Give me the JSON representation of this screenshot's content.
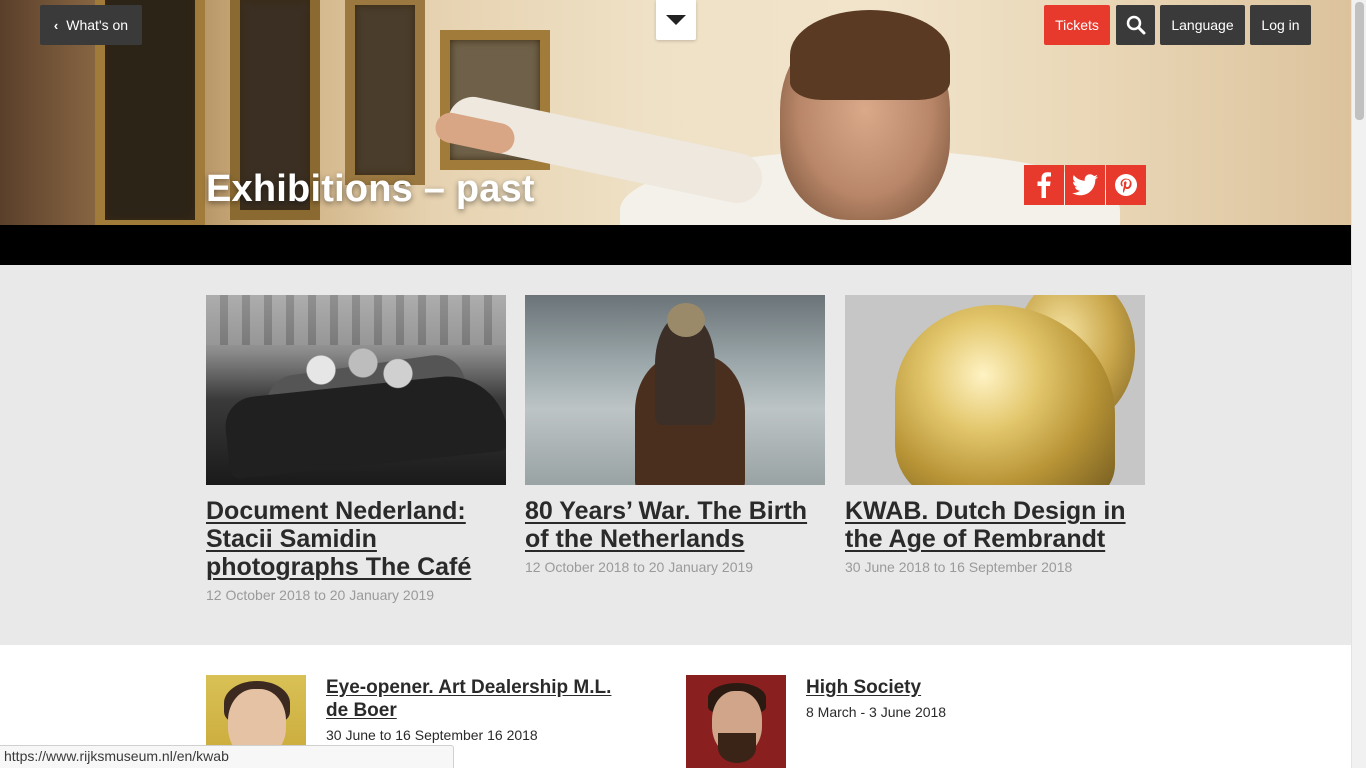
{
  "nav": {
    "back_label": "What's on",
    "tickets_label": "Tickets",
    "language_label": "Language",
    "login_label": "Log in"
  },
  "page": {
    "title": "Exhibitions – past"
  },
  "featured": [
    {
      "title": "Document Nederland: Stacii Samidin photographs The Café",
      "date": "12 October 2018 to 20 January 2019"
    },
    {
      "title": "80 Years’ War. The Birth of the Netherlands",
      "date": "12 October 2018 to 20 January 2019"
    },
    {
      "title": "KWAB. Dutch Design in the Age of Rembrandt",
      "date": "30 June 2018 to 16 September 2018"
    }
  ],
  "list": [
    {
      "title": "Eye-opener. Art Dealership M.L. de Boer",
      "date": "30 June to 16 September 16 2018"
    },
    {
      "title": "High Society",
      "date": "8 March - 3 June 2018"
    }
  ],
  "status_bar": {
    "url": "https://www.rijksmuseum.nl/en/kwab"
  },
  "colors": {
    "accent": "#e8392d",
    "dark_button": "#3a3a3a",
    "featured_bg": "#e9e9e9"
  }
}
